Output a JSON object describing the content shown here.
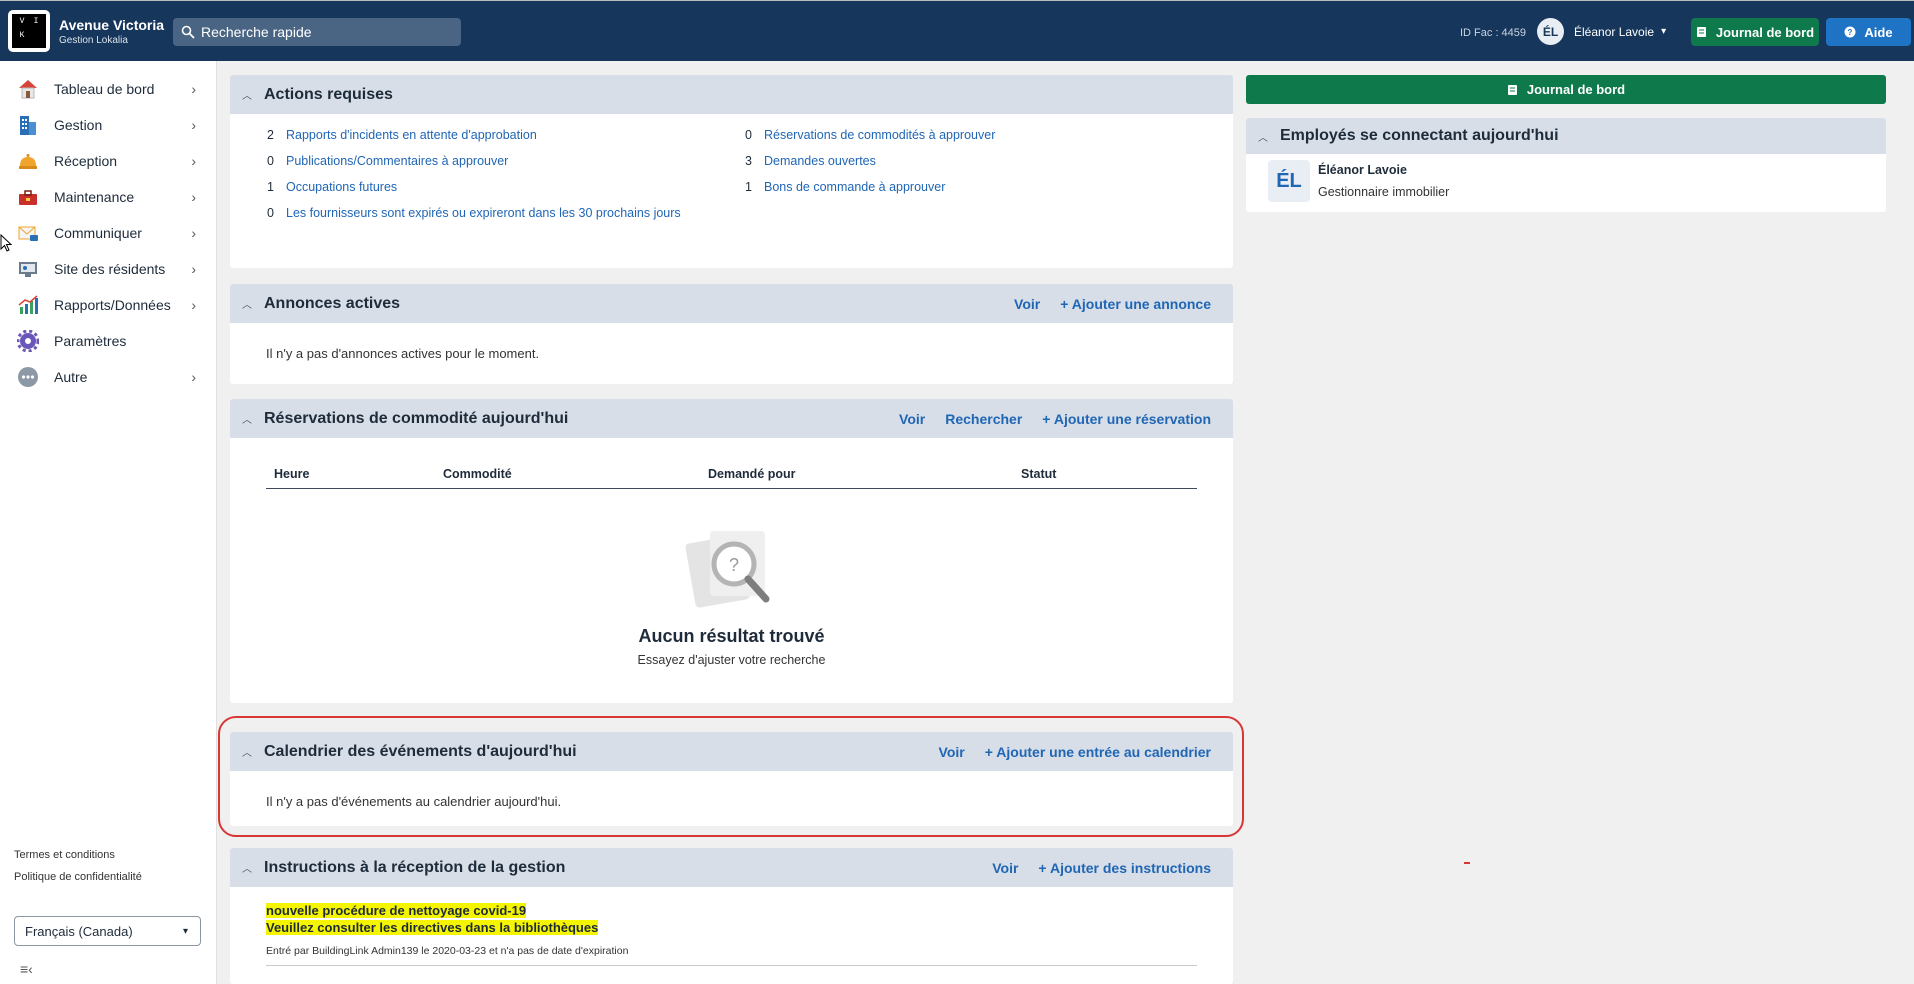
{
  "header": {
    "logo_letters": [
      "V",
      "I",
      "K",
      ""
    ],
    "logo_small": "Lokalia",
    "app_name": "Avenue Victoria",
    "app_sub": "Gestion Lokalia",
    "search_placeholder": "Recherche rapide",
    "fac_id": "ID Fac : 4459",
    "user_initials": "ÉL",
    "user_name": "Éléanor Lavoie",
    "journal_label": "Journal de bord",
    "aide_label": "Aide"
  },
  "sidebar": {
    "items": [
      {
        "label": "Tableau de bord",
        "icon": "house-icon",
        "arrow": true
      },
      {
        "label": "Gestion",
        "icon": "building-icon",
        "arrow": true
      },
      {
        "label": "Réception",
        "icon": "bell-icon",
        "arrow": true
      },
      {
        "label": "Maintenance",
        "icon": "toolbox-icon",
        "arrow": true
      },
      {
        "label": "Communiquer",
        "icon": "envelope-icon",
        "arrow": true
      },
      {
        "label": "Site des résidents",
        "icon": "monitor-icon",
        "arrow": true
      },
      {
        "label": "Rapports/Données",
        "icon": "chart-icon",
        "arrow": true
      },
      {
        "label": "Paramètres",
        "icon": "gear-icon",
        "arrow": false
      },
      {
        "label": "Autre",
        "icon": "more-icon",
        "arrow": true
      }
    ],
    "terms": "Termes et conditions",
    "privacy": "Politique de confidentialité",
    "language": "Français (Canada)"
  },
  "actions": {
    "title": "Actions requises",
    "items": [
      {
        "count": "2",
        "label": "Rapports d'incidents en attente d'approbation"
      },
      {
        "count": "0",
        "label": "Réservations de commodités à approuver"
      },
      {
        "count": "0",
        "label": "Publications/Commentaires à approuver"
      },
      {
        "count": "3",
        "label": "Demandes ouvertes"
      },
      {
        "count": "1",
        "label": "Occupations futures"
      },
      {
        "count": "1",
        "label": "Bons de commande à approuver"
      },
      {
        "count": "0",
        "label": "Les fournisseurs sont expirés ou expireront dans les 30 prochains jours"
      }
    ]
  },
  "announcements": {
    "title": "Annonces actives",
    "view": "Voir",
    "add": "+ Ajouter une annonce",
    "empty": "Il n'y a pas d'annonces actives pour le moment."
  },
  "reservations": {
    "title": "Réservations de commodité aujourd'hui",
    "view": "Voir",
    "search": "Rechercher",
    "add": "+ Ajouter une réservation",
    "columns": [
      "Heure",
      "Commodité",
      "Demandé pour",
      "Statut"
    ],
    "empty_title": "Aucun résultat trouvé",
    "empty_sub": "Essayez d'ajuster votre recherche"
  },
  "calendar": {
    "title": "Calendrier des événements d'aujourd'hui",
    "view": "Voir",
    "add": "+ Ajouter une entrée au calendrier",
    "empty": "Il n'y a pas d'événements au calendrier aujourd'hui."
  },
  "instructions": {
    "title": "Instructions à la réception de la gestion",
    "view": "Voir",
    "add": "+ Ajouter des instructions",
    "line1": "nouvelle procédure de nettoyage covid-19",
    "line2": "Veuillez consulter les directives dans la bibliothèques",
    "meta": "Entré par BuildingLink Admin139 le 2020-03-23 et n'a pas de date d'expiration"
  },
  "right": {
    "journal_label": "Journal de bord",
    "employees_title": "Employés se connectant aujourd'hui",
    "employee_initials": "ÉL",
    "employee_name": "Éléanor Lavoie",
    "employee_role": "Gestionnaire immobilier"
  }
}
